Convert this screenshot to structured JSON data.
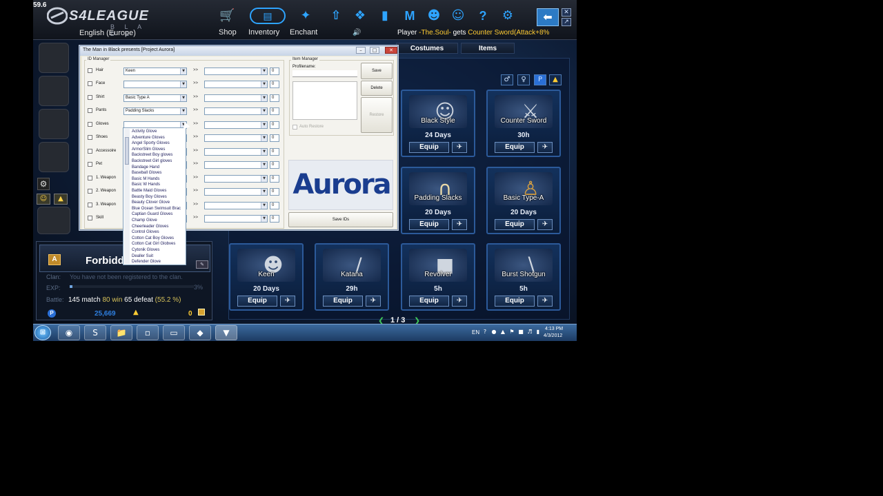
{
  "fps": "59.6",
  "game": {
    "logo_title": "S4LEAGUE",
    "logo_subtitle": "B L A D E",
    "language": "English (Europe)",
    "nav": [
      {
        "label": "Shop",
        "icon": "cart-icon"
      },
      {
        "label": "Inventory",
        "icon": "inventory-icon"
      },
      {
        "label": "Enchant",
        "icon": "enchant-icon"
      }
    ],
    "ticker": {
      "prefix": "Player",
      "name": "-The.Soul-",
      "middle": "gets",
      "item": "Counter Sword(Attack+8%"
    },
    "tabs": [
      "Costumes",
      "Items"
    ],
    "clan": {
      "name": "Forbidden",
      "clan_label": "Clan:",
      "clan_message": "You have not been registered to the clan.",
      "exp_label": "EXP:",
      "exp_pct": "3%",
      "battle_label": "Battle:",
      "matches": "145 match",
      "wins": "80 win",
      "defeats": "65 defeat",
      "win_rate": "(55.2 %)",
      "pen": "25,669",
      "ap": "0"
    },
    "items": [
      {
        "name": "Black Style",
        "duration": "24 Days",
        "equip": "Equip"
      },
      {
        "name": "Counter Sword",
        "duration": "30h",
        "equip": "Equip"
      },
      {
        "name": "Padding Slacks",
        "duration": "20 Days",
        "equip": "Equip"
      },
      {
        "name": "Basic Type-A",
        "duration": "20 Days",
        "equip": "Equip"
      },
      {
        "name": "Keen",
        "duration": "20 Days",
        "equip": "Equip"
      },
      {
        "name": "Katana",
        "duration": "29h",
        "equip": "Equip"
      },
      {
        "name": "Revolver",
        "duration": "5h",
        "equip": "Equip"
      },
      {
        "name": "Burst Shotgun",
        "duration": "5h",
        "equip": "Equip"
      }
    ],
    "pager": "1 / 3"
  },
  "trainer": {
    "title": "The Man in Black presents [Project Aurora]",
    "id_manager_label": "ID Manager",
    "item_manager_label": "Item Manager",
    "profilename_label": "Profilename:",
    "rows": [
      {
        "label": "Hair",
        "value": "Keen",
        "num": "0"
      },
      {
        "label": "Face",
        "value": "",
        "num": "0"
      },
      {
        "label": "Shirt",
        "value": "Basic Type A",
        "num": "0"
      },
      {
        "label": "Pants",
        "value": "Padding Slacks",
        "num": "0"
      },
      {
        "label": "Gloves",
        "value": "",
        "num": "0"
      },
      {
        "label": "Shoes",
        "value": "",
        "num": "0"
      },
      {
        "label": "Accessoire",
        "value": "",
        "num": "0"
      },
      {
        "label": "Pet",
        "value": "",
        "num": "0"
      },
      {
        "label": "1. Weapon",
        "value": "",
        "num": "0"
      },
      {
        "label": "2. Weapon",
        "value": "",
        "num": "0"
      },
      {
        "label": "3. Weapon",
        "value": "",
        "num": "0"
      },
      {
        "label": "Skill",
        "value": "",
        "num": "0"
      }
    ],
    "arrow_text": ">>",
    "save_label": "Save",
    "delete_label": "Delete",
    "restore_label": "Restore",
    "auto_restore_label": "Auto Restore",
    "save_ids_label": "Save IDs",
    "logo_text": "Aurora",
    "gloves_options": [
      "Activity Glove",
      "Adventure Gloves",
      "Angel Sporty Gloves",
      "ArmorSlim Gloves",
      "Backstreet Boy gloves",
      "Backstreet Girl gloves",
      "Bandage Hand",
      "Baseball Gloves",
      "Basic M Hands",
      "Basic W Hands",
      "Battle Maid Gloves",
      "Beasty Boy Gloves",
      "Beauty Clover Glove",
      "Blue Ocean Swimsuit Brac",
      "Captian Guard Gloves",
      "Champ Glove",
      "Cheerleader Gloves",
      "Control Gloves",
      "Cotton Cat Boy Gloves",
      "Cotton Cat Girl Globves",
      "Cytonik Gloves",
      "Dealler Suit",
      "Defender Glove"
    ]
  },
  "taskbar": {
    "lang": "EN",
    "time": "4:13 PM",
    "date": "4/3/2012"
  }
}
